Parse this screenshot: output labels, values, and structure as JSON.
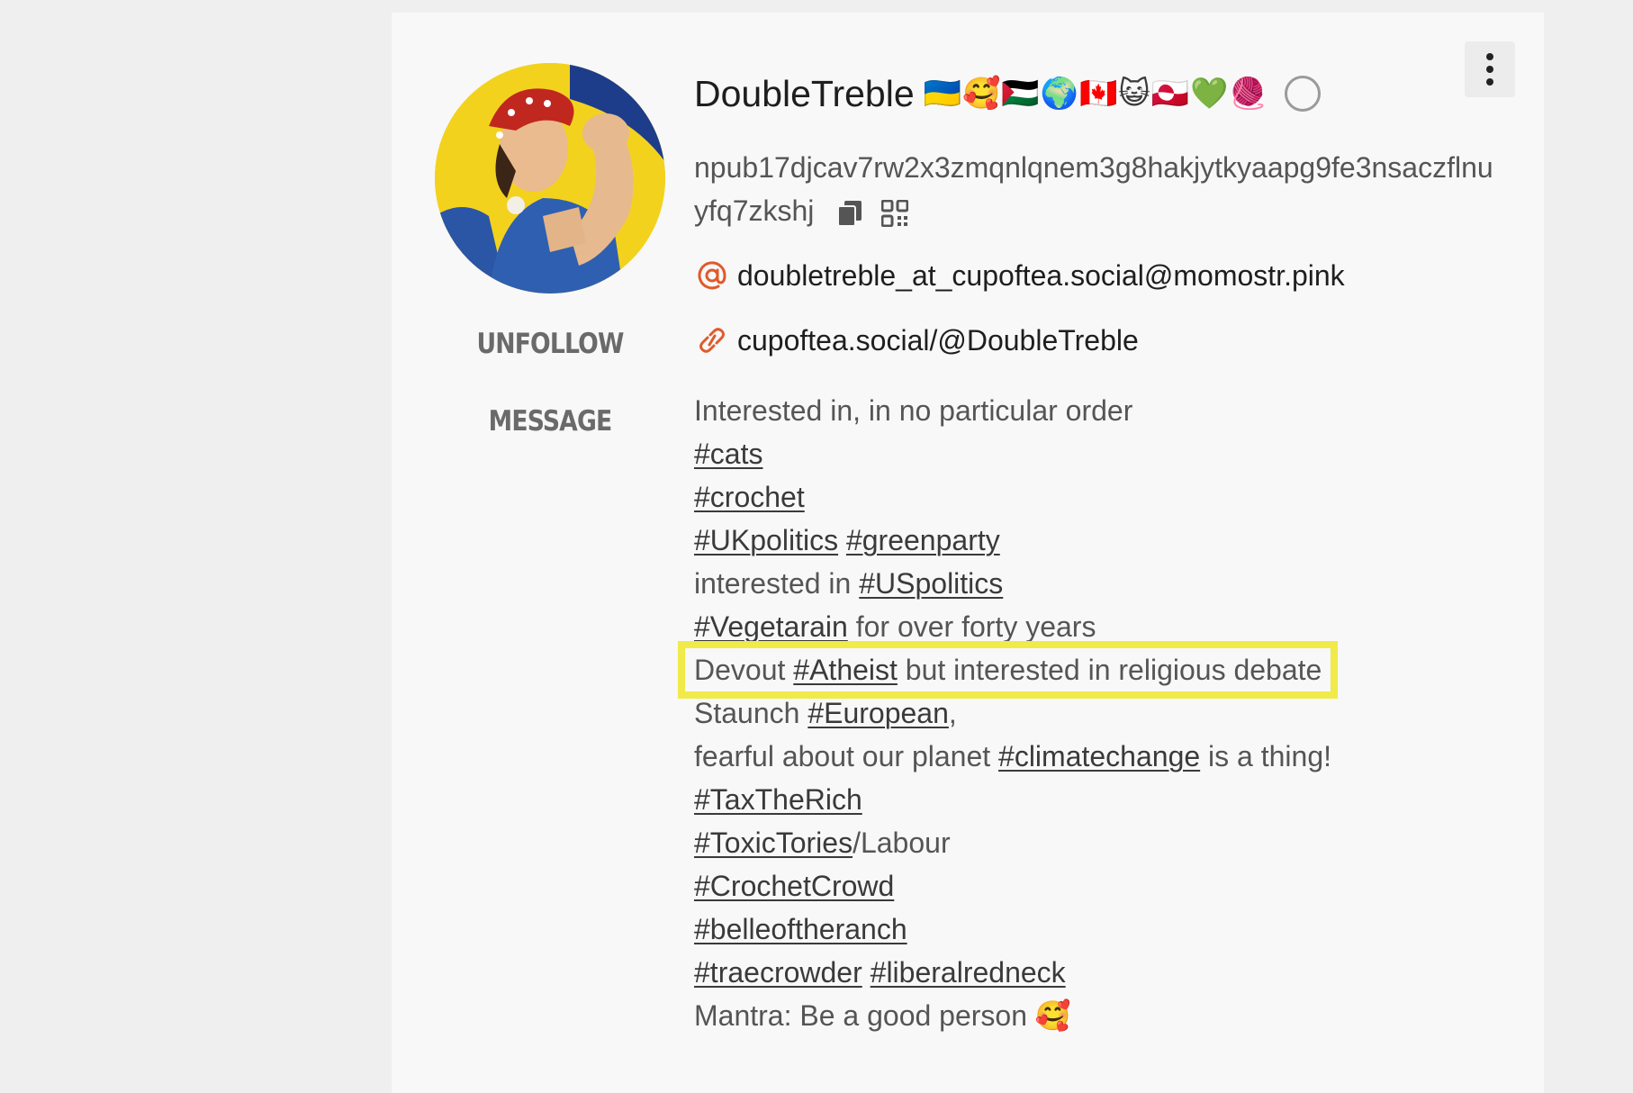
{
  "profile": {
    "display_name": "DoubleTreble",
    "name_emojis": "🇺🇦🥰🇵🇸🌍🇨🇦😺🇬🇱💚🧶",
    "npub": "npub17djcav7rw2x3zmqnlqnem3g8hakjytkyaapg9fe3nsaczflnuyfq7zkshj",
    "nip05": "doubletreble_at_cupoftea.social@momostr.pink",
    "website": "cupoftea.social/@DoubleTreble"
  },
  "actions": {
    "unfollow_label": "UNFOLLOW",
    "message_label": "MESSAGE"
  },
  "bio": {
    "l1": "Interested in, in no particular order",
    "l2_tag": "#cats",
    "l3_tag": "#crochet",
    "l4_tag1": "#UKpolitics",
    "l4_tag2": "#greenparty",
    "l5_pre": "interested in ",
    "l5_tag": "#USpolitics",
    "l6_tag": "#Vegetarain",
    "l6_post": " for over forty years",
    "l7_pre": "Devout ",
    "l7_tag": "#Atheist",
    "l7_post": " but interested in religious debate",
    "l8_pre": "Staunch ",
    "l8_tag": "#European",
    "l8_post": ",",
    "l9_pre": "fearful about our planet ",
    "l9_tag": "#climatechange",
    "l9_post": " is a thing!",
    "l10_tag": "#TaxTheRich",
    "l11_tag": "#ToxicTories",
    "l11_post": "/Labour",
    "l12_tag": "#CrochetCrowd",
    "l13_tag": "#belleoftheranch",
    "l14_tag1": "#traecrowder",
    "l14_tag2": "#liberalredneck",
    "l15": "Mantra: Be a good person ",
    "l15_emoji": "🥰"
  },
  "colors": {
    "accent": "#e05a2b",
    "highlight": "#f0ea4a",
    "card_bg": "#f8f8f8",
    "page_bg": "#efefef"
  },
  "icons": {
    "copy": "copy-icon",
    "qr": "qr-code-icon",
    "nip05": "at-sign-icon",
    "website": "link-icon",
    "menu": "more-vertical-icon",
    "status": "status-circle-icon"
  }
}
